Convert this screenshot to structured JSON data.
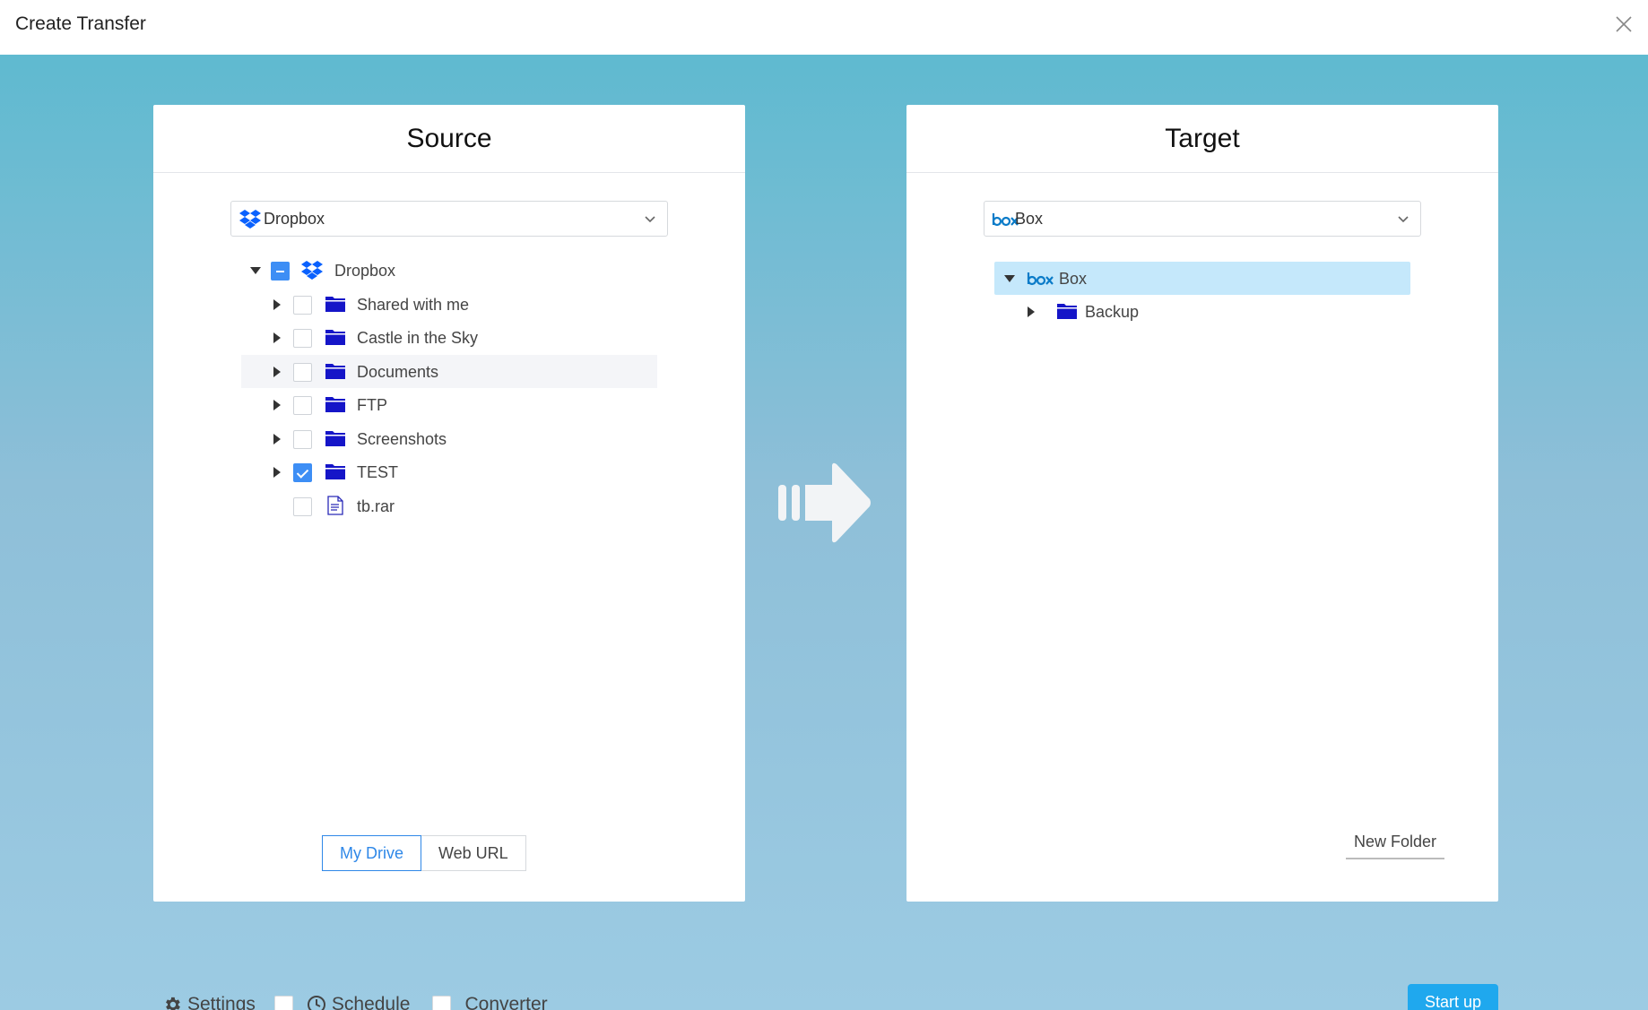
{
  "window": {
    "title": "Create Transfer",
    "close_icon": "close-icon"
  },
  "source": {
    "header": "Source",
    "selected_service": "Dropbox",
    "tree": {
      "root": {
        "label": "Dropbox",
        "state": "partial"
      },
      "items": [
        {
          "label": "Shared with me",
          "type": "folder",
          "checked": false
        },
        {
          "label": "Castle in the Sky",
          "type": "folder",
          "checked": false
        },
        {
          "label": "Documents",
          "type": "folder",
          "checked": false
        },
        {
          "label": "FTP",
          "type": "folder",
          "checked": false
        },
        {
          "label": "Screenshots",
          "type": "folder",
          "checked": false
        },
        {
          "label": "TEST",
          "type": "folder",
          "checked": true
        },
        {
          "label": "tb.rar",
          "type": "file",
          "checked": false
        }
      ]
    },
    "tabs": {
      "my_drive": "My Drive",
      "web_url": "Web URL",
      "active": "My Drive"
    }
  },
  "target": {
    "header": "Target",
    "selected_service": "Box",
    "tree": {
      "root": {
        "label": "Box"
      },
      "items": [
        {
          "label": "Backup",
          "type": "folder"
        }
      ]
    },
    "new_folder": "New Folder"
  },
  "bottom": {
    "settings": "Settings",
    "schedule": "Schedule",
    "converter": "Converter",
    "start": "Start up"
  },
  "colors": {
    "accent": "#1fa8ee",
    "folder": "#1515c8",
    "dropbox": "#0a61fe",
    "box": "#0a7bc8",
    "selected_row": "#c5e8fb"
  }
}
